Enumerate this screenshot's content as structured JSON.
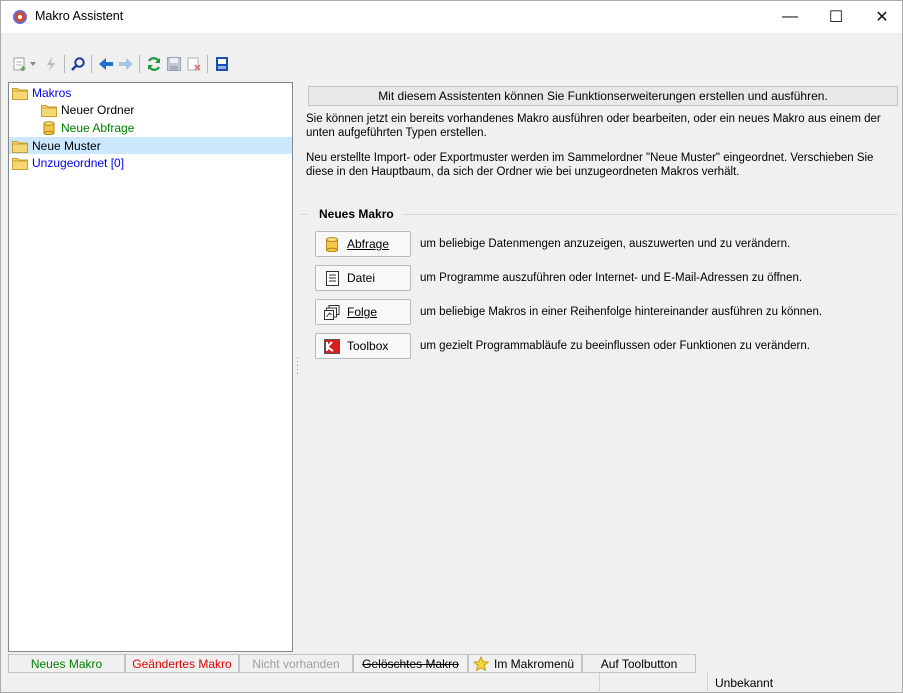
{
  "window": {
    "title": "Makro Assistent",
    "controls": {
      "minimize": "—",
      "maximize": "☐",
      "close": "✕"
    }
  },
  "toolbar": {
    "items": [
      {
        "name": "new-item-button",
        "icon": "new-doc-icon"
      },
      {
        "name": "dropdown-arrow-button",
        "icon": "chevron-down-icon"
      },
      {
        "name": "lightning-button",
        "icon": "lightning-icon"
      },
      {
        "name": "search-button",
        "icon": "search-icon"
      },
      {
        "name": "back-button",
        "icon": "arrow-left-icon"
      },
      {
        "name": "forward-button",
        "icon": "arrow-right-icon"
      },
      {
        "name": "refresh-button",
        "icon": "refresh-icon"
      },
      {
        "name": "save-button",
        "icon": "save-icon"
      },
      {
        "name": "delete-button",
        "icon": "delete-icon"
      },
      {
        "name": "info-button",
        "icon": "info-icon"
      }
    ]
  },
  "tree": {
    "items": [
      {
        "label": "Makros",
        "icon": "folder-icon",
        "color": "#0000ee",
        "level": 0
      },
      {
        "label": "Neuer Ordner",
        "icon": "folder-icon",
        "color": "#000000",
        "level": 1
      },
      {
        "label": "Neue Abfrage",
        "icon": "database-icon",
        "color": "#008000",
        "level": 1
      },
      {
        "label": "Neue Muster",
        "icon": "folder-icon",
        "color": "#000000",
        "level": 0,
        "selected": true
      },
      {
        "label": "Unzugeordnet [0]",
        "icon": "folder-icon",
        "color": "#0000ee",
        "level": 0
      }
    ]
  },
  "main": {
    "banner": "Mit diesem Assistenten können Sie Funktionserweiterungen erstellen und ausführen.",
    "para1": "Sie können jetzt ein bereits vorhandenes Makro ausführen oder bearbeiten, oder ein neues Makro aus einem der unten aufgeführten Typen erstellen.",
    "para2": "Neu erstellte Import- oder Exportmuster werden im Sammelordner \"Neue Muster\" eingeordnet. Verschieben Sie diese in den Hauptbaum, da sich der Ordner wie bei unzugeordneten Makros verhält.",
    "group_title": "Neues Makro",
    "buttons": [
      {
        "label": "Abfrage",
        "icon": "database-icon",
        "desc": "um beliebige Datenmengen anzuzeigen, auszuwerten und zu verändern."
      },
      {
        "label": "Datei",
        "icon": "file-icon",
        "desc": "um Programme auszuführen oder Internet- und E-Mail-Adressen zu öffnen."
      },
      {
        "label": "Folge",
        "icon": "sequence-icon",
        "desc": "um beliebige Makros in einer Reihenfolge hintereinander ausführen zu können."
      },
      {
        "label": "Toolbox",
        "icon": "toolbox-icon",
        "desc": "um gezielt Programmabläufe zu beeinflussen oder Funktionen zu verändern."
      }
    ]
  },
  "legend": {
    "items": [
      {
        "label": "Neues Makro",
        "color": "#008000"
      },
      {
        "label": "Geändertes Makro",
        "color": "#e00000"
      },
      {
        "label": "Nicht vorhanden",
        "color": "#a0a0a0"
      },
      {
        "label": "Gelöschtes Makro",
        "color": "#000000",
        "strike": true
      },
      {
        "label": "Im Makromenü",
        "color": "#000000",
        "icon": "star-icon"
      },
      {
        "label": "Auf Toolbutton",
        "color": "#000000"
      }
    ]
  },
  "status": {
    "text": "Unbekannt"
  }
}
